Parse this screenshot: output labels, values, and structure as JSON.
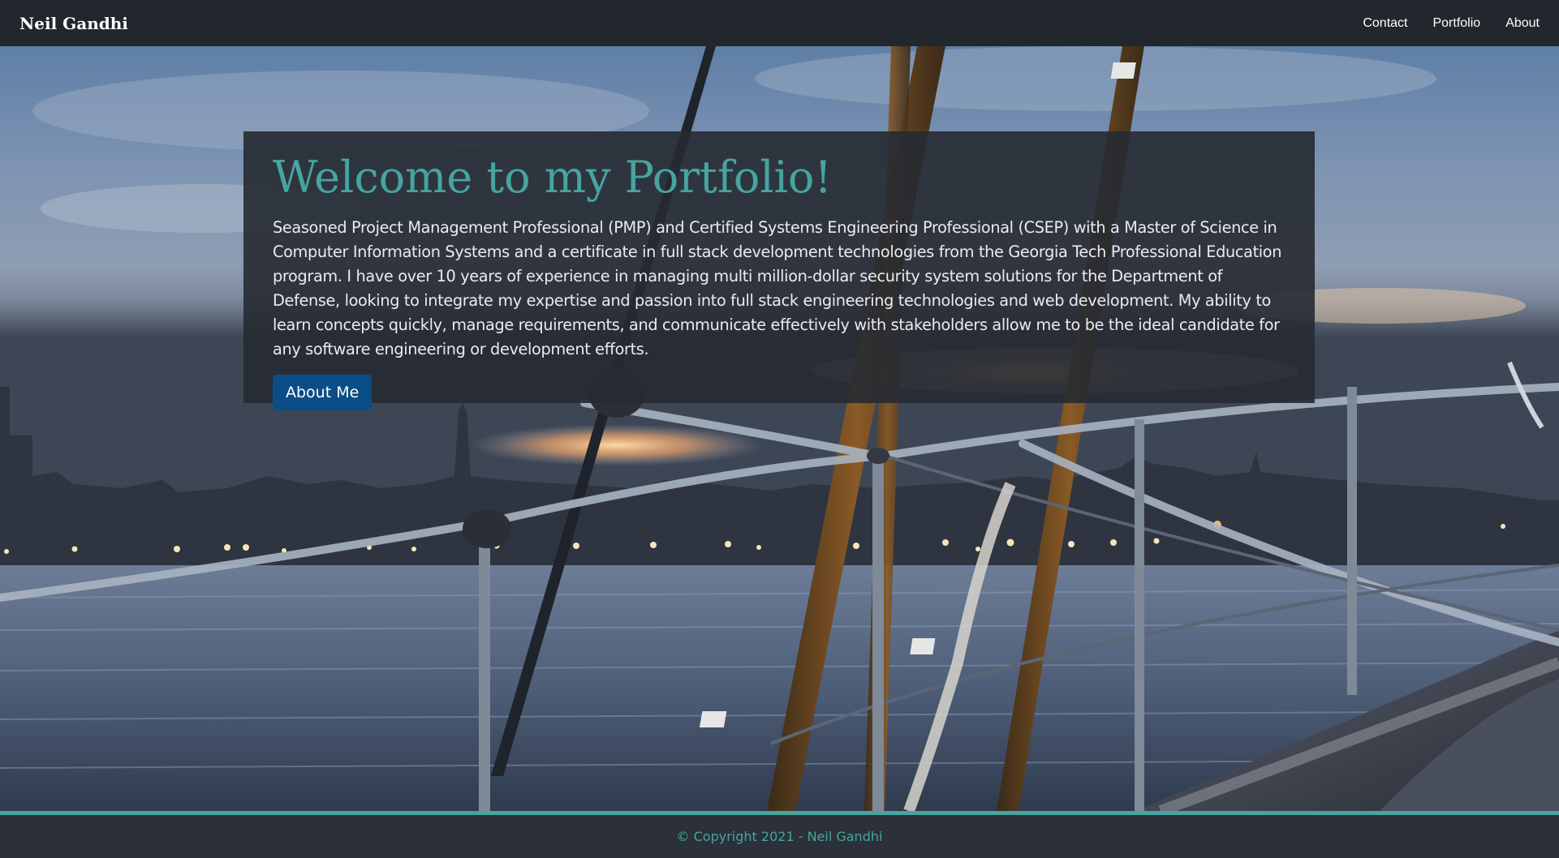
{
  "navbar": {
    "brand": "Neil Gandhi",
    "links": [
      {
        "label": "Contact"
      },
      {
        "label": "Portfolio"
      },
      {
        "label": "About"
      }
    ]
  },
  "hero": {
    "background_image": "sailboat-harbor-dusk",
    "title": "Welcome to my Portfolio!",
    "description": "Seasoned Project Management Professional (PMP) and Certified Systems Engineering Professional (CSEP) with a Master of Science in Computer Information Systems and a certificate in full stack development technologies from the Georgia Tech Professional Education program. I have over 10 years of experience in managing multi million-dollar security system solutions for the Department of Defense, looking to integrate my expertise and passion into full stack engineering technologies and web development. My ability to learn concepts quickly, manage requirements, and communicate effectively with stakeholders allow me to be the ideal candidate for any software engineering or development efforts.",
    "button_label": "About Me"
  },
  "footer": {
    "copyright": "© Copyright 2021 - Neil Gandhi"
  },
  "colors": {
    "navbar_bg": "#22262d",
    "accent": "#46a5a0",
    "button_bg": "#0b4d86",
    "footer_bg": "#2c3038"
  }
}
